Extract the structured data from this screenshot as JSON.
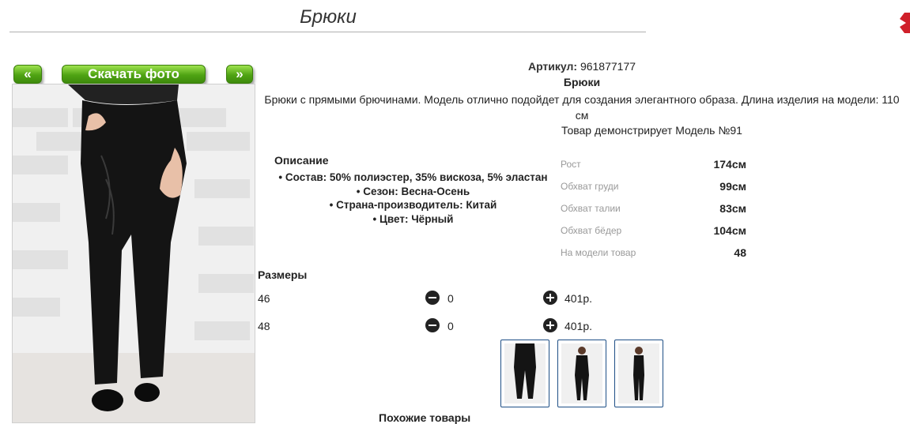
{
  "header": {
    "title": "Брюки"
  },
  "gallery": {
    "prev_label": "«",
    "download_label": "Скачать фото",
    "next_label": "»"
  },
  "product": {
    "sku_label": "Артикул:",
    "sku_value": "961877177",
    "name": "Брюки",
    "description": "Брюки с прямыми брючинами. Модель отлично подойдет для создания элегантного образа. Длина изделия на модели: 110 см",
    "model_note": "Товар демонстрирует Модель №91"
  },
  "details": {
    "heading": "Описание",
    "items": [
      "Состав: 50% полиэстер, 35% вискоза, 5% эластан",
      "Сезон: Весна-Осень",
      "Страна-производитель: Китай",
      "Цвет: Чёрный"
    ]
  },
  "measurements": [
    {
      "label": "Рост",
      "value": "174см"
    },
    {
      "label": "Обхват груди",
      "value": "99см"
    },
    {
      "label": "Обхват талии",
      "value": "83см"
    },
    {
      "label": "Обхват бёдер",
      "value": "104см"
    },
    {
      "label": "На модели товар",
      "value": "48"
    }
  ],
  "sizes": {
    "heading": "Размеры",
    "rows": [
      {
        "size": "46",
        "qty": "0",
        "price": "401р."
      },
      {
        "size": "48",
        "qty": "0",
        "price": "401р."
      }
    ]
  },
  "similar": {
    "heading": "Похожие товары"
  },
  "colors": {
    "button_green": "#4fa313",
    "thumb_border": "#1e4f86",
    "close_red": "#d0202a"
  }
}
